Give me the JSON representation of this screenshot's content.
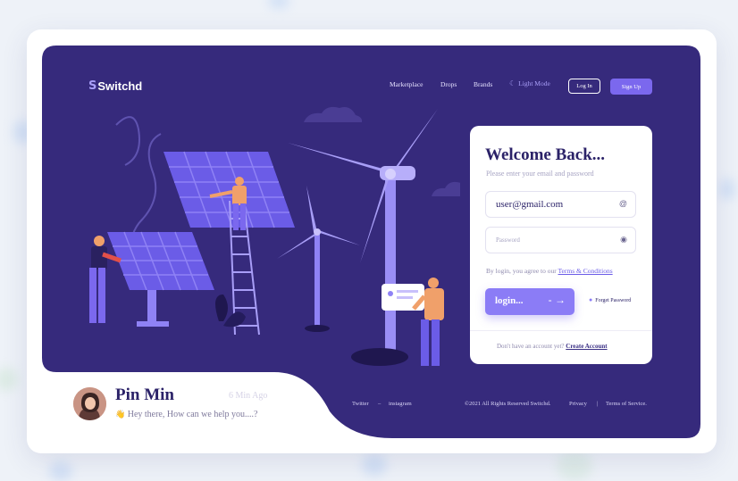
{
  "colors": {
    "hero_bg": "#362a7c",
    "accent": "#7b68ee",
    "panel_title": "#2b2268"
  },
  "brand": {
    "name": "Switchd",
    "mark": "S"
  },
  "nav": {
    "items": [
      "Marketplace",
      "Drops",
      "Brands"
    ],
    "light_mode": "Light Mode",
    "login": "Log In",
    "signup": "Sign Up"
  },
  "login_panel": {
    "title": "Welcome Back...",
    "subtitle": "Please enter your email and password",
    "email_value": "user@gmail.com",
    "password_placeholder": "Password",
    "agree_text": "By login, you agree to our",
    "terms_link": "Terms & Conditions",
    "login_button": "login...",
    "forgot": "Forget Password",
    "no_account": "Don't have an account yet?",
    "create_link": "Create Account"
  },
  "footer": {
    "twitter": "Twitter",
    "separator": "–",
    "instagram": "instagram",
    "copyright": "©2021 All Rights Reserved Switchd.",
    "privacy": "Privacy",
    "pipe": "|",
    "terms": "Terms of Service."
  },
  "chat": {
    "name": "Pin Min",
    "time": "6 Min Ago",
    "wave": "👋",
    "message": "Hey there, How can we help you....?"
  }
}
